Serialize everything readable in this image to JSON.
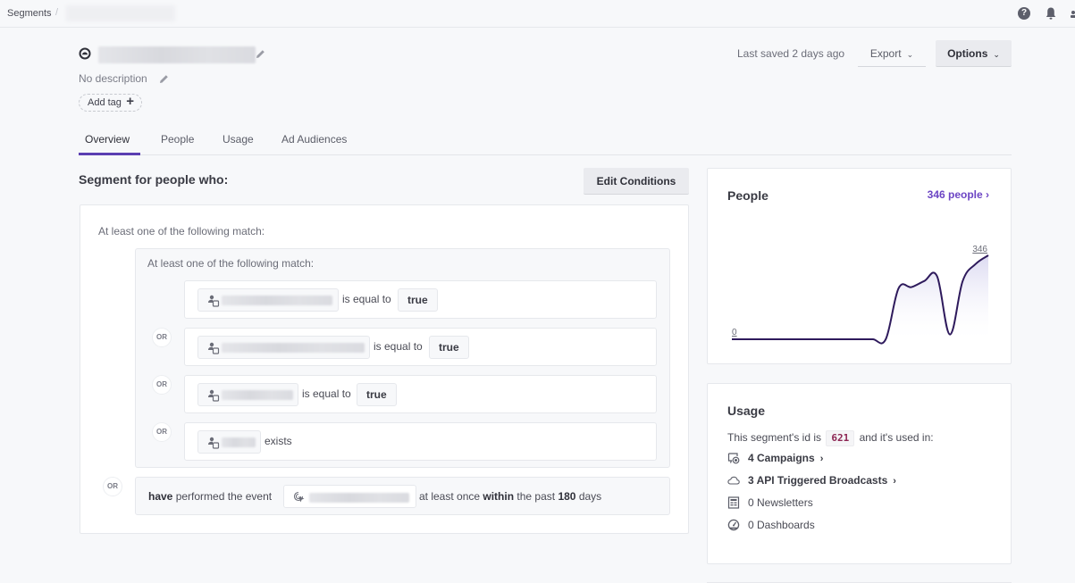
{
  "breadcrumb": {
    "root": "Segments",
    "separator": "/"
  },
  "topbar": {
    "help_icon": "question-circle-icon",
    "notification_icon": "bell-icon",
    "user_icon": "user-icon"
  },
  "segment": {
    "type_icon": "data-driven-segment-icon",
    "description": "No description",
    "add_tag_label": "Add tag",
    "add_tag_icon": "+"
  },
  "header": {
    "last_saved": "Last saved 2 days ago",
    "export_label": "Export",
    "options_label": "Options",
    "chevron": "⌄"
  },
  "tabs": [
    {
      "label": "Overview",
      "active": true
    },
    {
      "label": "People",
      "active": false
    },
    {
      "label": "Usage",
      "active": false
    },
    {
      "label": "Ad Audiences",
      "active": false
    }
  ],
  "conditions": {
    "heading": "Segment for people who:",
    "edit_label": "Edit Conditions",
    "outer_match": "At least one of the following match:",
    "inner_match": "At least one of the following match:",
    "or_label": "OR",
    "rules": [
      {
        "operator": "is equal to",
        "value": "true"
      },
      {
        "operator": "is equal to",
        "value": "true"
      },
      {
        "operator": "is equal to",
        "value": "true"
      },
      {
        "operator": "exists",
        "value": null
      }
    ],
    "event_rule": {
      "have": "have",
      "performed": "performed the event",
      "at_least_once": "at least once",
      "within": "within",
      "the_past": "the past",
      "days_count": "180",
      "days": "days"
    }
  },
  "people_card": {
    "title": "People",
    "link": "346 people ›",
    "accent": "#6c45c4"
  },
  "chart_data": {
    "type": "area",
    "title": "People",
    "y_min_label": "0",
    "y_max_label": "346",
    "ylim": [
      0,
      346
    ],
    "x": [
      0,
      1,
      2,
      3,
      4,
      5,
      6,
      7,
      8,
      9,
      10,
      11,
      12,
      13,
      14,
      15,
      16,
      17,
      18,
      19,
      20
    ],
    "values": [
      0,
      0,
      0,
      0,
      0,
      0,
      0,
      0,
      0,
      0,
      0,
      0,
      0,
      210,
      215,
      240,
      260,
      20,
      240,
      310,
      346
    ],
    "line_color": "#2e1a5c",
    "grid": false
  },
  "usage_card": {
    "title": "Usage",
    "desc_prefix": "This segment's id is",
    "segment_id": "621",
    "desc_suffix": "and it's used in:",
    "items": [
      {
        "icon": "campaign-icon",
        "label": "4 Campaigns",
        "link": true
      },
      {
        "icon": "cloud-icon",
        "label": "3 API Triggered Broadcasts",
        "link": true
      },
      {
        "icon": "newsletter-icon",
        "label": "0 Newsletters",
        "link": false
      },
      {
        "icon": "dashboard-gauge-icon",
        "label": "0 Dashboards",
        "link": false
      }
    ],
    "arrow": "›"
  }
}
